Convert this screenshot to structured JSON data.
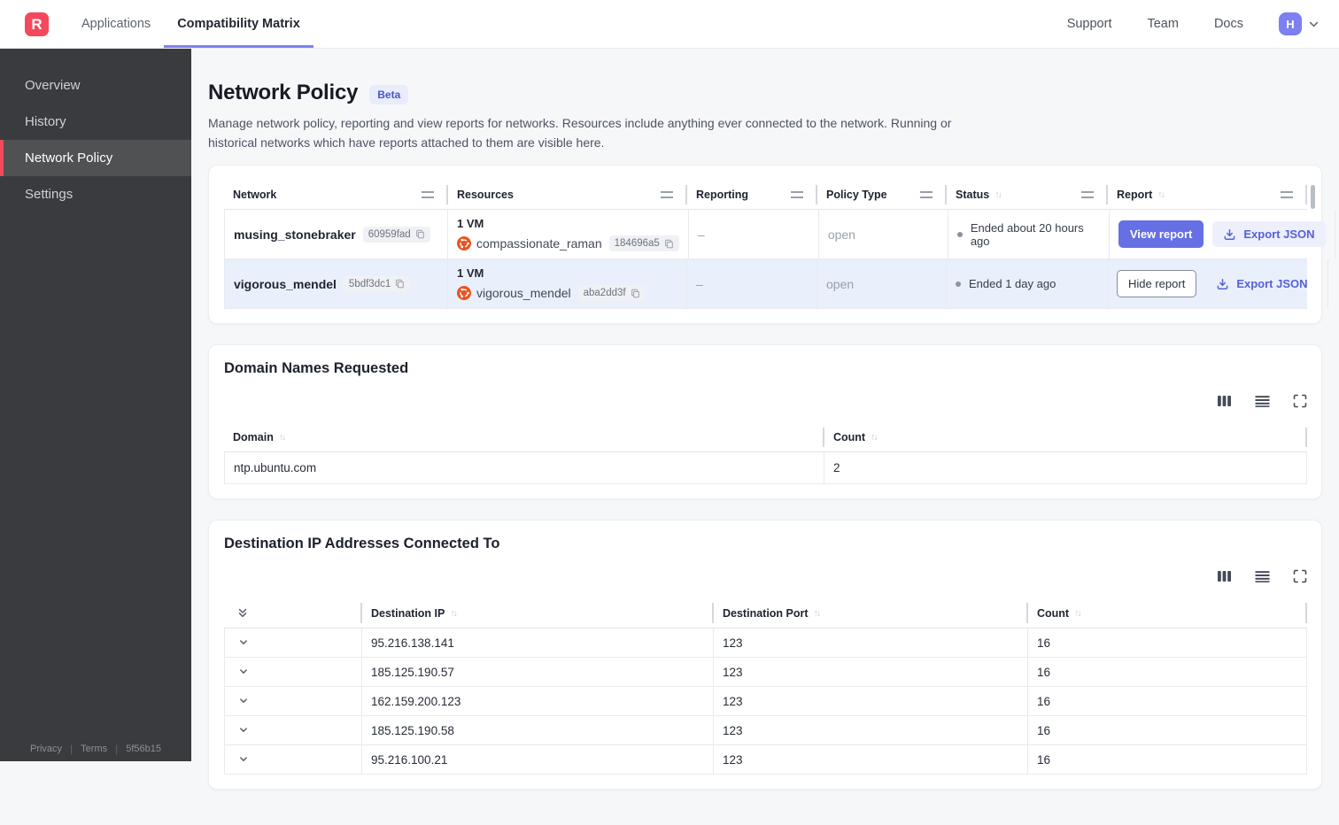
{
  "topnav": {
    "logo_letter": "R",
    "tabs": [
      {
        "label": "Applications",
        "active": false
      },
      {
        "label": "Compatibility Matrix",
        "active": true
      }
    ],
    "links": [
      {
        "label": "Support"
      },
      {
        "label": "Team"
      },
      {
        "label": "Docs"
      }
    ],
    "avatar_letter": "H"
  },
  "sidebar": {
    "items": [
      {
        "label": "Overview",
        "active": false
      },
      {
        "label": "History",
        "active": false
      },
      {
        "label": "Network Policy",
        "active": true
      },
      {
        "label": "Settings",
        "active": false
      }
    ],
    "footer_links": [
      {
        "label": "Privacy"
      },
      {
        "label": "Terms"
      }
    ],
    "build_id": "5f56b15"
  },
  "page": {
    "title": "Network Policy",
    "beta_badge": "Beta",
    "description": "Manage network policy, reporting and view reports for networks. Resources include anything ever connected to the network. Running or historical networks which have reports attached to them are visible here."
  },
  "networks_table": {
    "columns": [
      {
        "label": "Network"
      },
      {
        "label": "Resources"
      },
      {
        "label": "Reporting"
      },
      {
        "label": "Policy Type"
      },
      {
        "label": "Status"
      },
      {
        "label": "Report"
      }
    ],
    "rows": [
      {
        "network_name": "musing_stonebraker",
        "network_id": "60959fad",
        "resource_count": "1 VM",
        "resource_name": "compassionate_raman",
        "resource_id": "184696a5",
        "reporting": "–",
        "policy_type": "open",
        "status": "Ended about 20 hours ago",
        "report_action": "View report",
        "export_action": "Export JSON",
        "highlighted": false
      },
      {
        "network_name": "vigorous_mendel",
        "network_id": "5bdf3dc1",
        "resource_count": "1 VM",
        "resource_name": "vigorous_mendel",
        "resource_id": "aba2dd3f",
        "reporting": "–",
        "policy_type": "open",
        "status": "Ended 1 day ago",
        "report_action": "Hide report",
        "export_action": "Export JSON",
        "highlighted": true
      }
    ]
  },
  "domains_card": {
    "title": "Domain Names Requested",
    "columns": [
      {
        "label": "Domain"
      },
      {
        "label": "Count"
      }
    ],
    "rows": [
      {
        "domain": "ntp.ubuntu.com",
        "count": "2"
      }
    ]
  },
  "destinations_card": {
    "title": "Destination IP Addresses Connected To",
    "columns": [
      {
        "label": "Destination IP"
      },
      {
        "label": "Destination Port"
      },
      {
        "label": "Count"
      }
    ],
    "rows": [
      {
        "ip": "95.216.138.141",
        "port": "123",
        "count": "16"
      },
      {
        "ip": "185.125.190.57",
        "port": "123",
        "count": "16"
      },
      {
        "ip": "162.159.200.123",
        "port": "123",
        "count": "16"
      },
      {
        "ip": "185.125.190.58",
        "port": "123",
        "count": "16"
      },
      {
        "ip": "95.216.100.21",
        "port": "123",
        "count": "16"
      }
    ]
  },
  "icons": {
    "ubuntu": "orange circle-of-friends logo",
    "copy": "duplicate squares",
    "download": "arrow into tray",
    "sort": "↑↓",
    "drag_handle": "=",
    "columns_view": "▮▮▮",
    "rows_view": "≡",
    "fullscreen": "corner brackets",
    "chevron_down": "⌄",
    "double_chevron_down": "⌄⌄",
    "status_dot": "●"
  },
  "colors": {
    "brand_red": "#F4485C",
    "accent_purple": "#666FE4",
    "active_tab_underline": "#7D83EE",
    "avatar_bg": "#7B80F2",
    "beta_badge_bg": "#E9ECFA",
    "beta_badge_text": "#4A54C8",
    "highlighted_row_bg": "#E9F0FB",
    "sidebar_bg": "#3A3B3E",
    "sidebar_active_bg": "#505153",
    "export_button_bg": "#EDEFFC",
    "export_button_text": "#5660D8",
    "ubuntu_orange": "#E95420"
  }
}
